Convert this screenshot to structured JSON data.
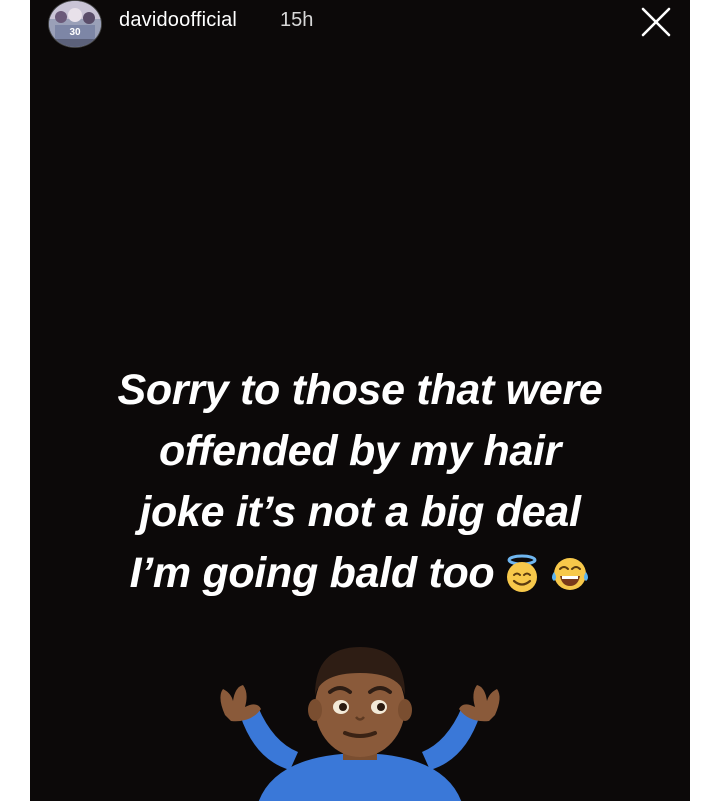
{
  "story": {
    "username": "davidoofficial",
    "time": "15h",
    "avatar_icon": "profile-avatar",
    "close_icon": "close-icon",
    "caption_lines": [
      "Sorry to those that were",
      "offended by my hair",
      "joke it’s not a big deal",
      "I’m going bald too"
    ],
    "caption_emojis": [
      "smiling-face-with-halo-icon",
      "tears-of-joy-icon"
    ],
    "sticker": "man-shrugging-icon",
    "colors": {
      "background": "#0c0909",
      "text": "#ffffff",
      "frame": "#ffffff"
    }
  }
}
